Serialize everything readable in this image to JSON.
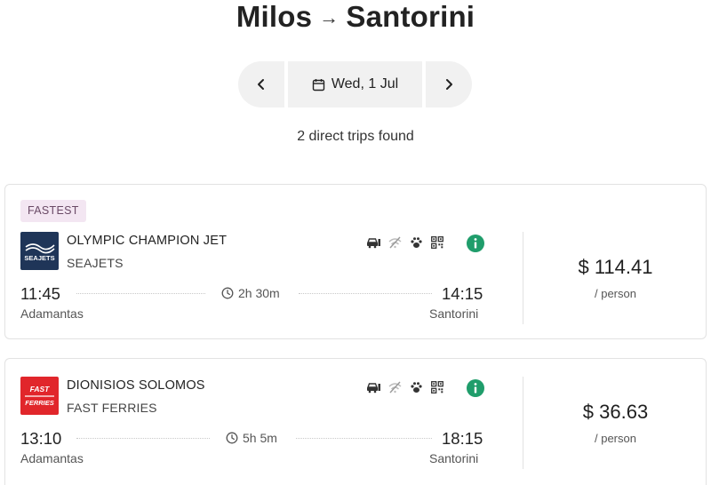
{
  "header": {
    "origin": "Milos",
    "arrow": "→",
    "destination": "Santorini"
  },
  "date_nav": {
    "date": "Wed, 1 Jul",
    "prev_icon": "chevron-left-icon",
    "next_icon": "chevron-right-icon",
    "calendar_icon": "calendar-icon"
  },
  "summary": "2 direct trips found",
  "trips": [
    {
      "badge": "FASTEST",
      "vessel": "OLYMPIC CHAMPION JET",
      "operator": "SEAJETS",
      "logo_text": "SEAJETS",
      "logo_color": "#1f3558",
      "amenities": [
        "car-icon",
        "no-wifi-icon",
        "pet-icon",
        "qr-code-icon"
      ],
      "info_icon": "info-icon",
      "depart_time": "11:45",
      "depart_port": "Adamantas",
      "duration": "2h 30m",
      "arrive_time": "14:15",
      "arrive_port": "Santorini",
      "price": "$ 114.41",
      "per": "/ person"
    },
    {
      "badge": "",
      "vessel": "DIONISIOS SOLOMOS",
      "operator": "FAST FERRIES",
      "logo_text_1": "FAST",
      "logo_text_2": "FERRIES",
      "logo_color": "#e1262b",
      "amenities": [
        "car-icon",
        "no-wifi-icon",
        "pet-icon",
        "qr-code-icon"
      ],
      "info_icon": "info-icon",
      "depart_time": "13:10",
      "depart_port": "Adamantas",
      "duration": "5h 5m",
      "arrive_time": "18:15",
      "arrive_port": "Santorini",
      "price": "$ 36.63",
      "per": "/ person"
    }
  ],
  "colors": {
    "accent_green": "#1f9d6b",
    "badge_bg": "#f3e6f2",
    "nav_bg": "#f1f1f1"
  }
}
